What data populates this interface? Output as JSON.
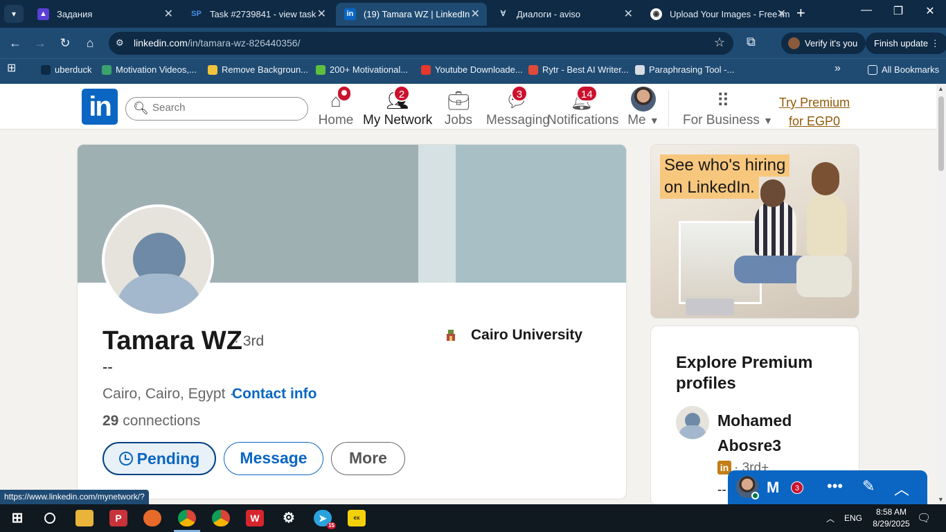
{
  "browser": {
    "tabs": [
      {
        "title": "Задания",
        "active": false
      },
      {
        "title": "Task #2739841 - view task",
        "active": false
      },
      {
        "title": "(19) Tamara WZ | LinkedIn",
        "active": true
      },
      {
        "title": "Диалоги - aviso",
        "active": false
      },
      {
        "title": "Upload Your Images - Free Im",
        "active": false
      }
    ],
    "url_host": "linkedin.com",
    "url_path": "/in/tamara-wz-826440356/",
    "verify_label": "Verify it's you",
    "update_label": "Finish update",
    "bookmarks": [
      "uberduck",
      "Motivation Videos,...",
      "Remove Backgroun...",
      "200+ Motivational...",
      "Youtube Downloade...",
      "Rytr - Best AI Writer...",
      "Paraphrasing Tool -..."
    ],
    "all_bookmarks": "All Bookmarks",
    "status_url": "https://www.linkedin.com/mynetwork/?"
  },
  "linkedin": {
    "logo": "in",
    "search_placeholder": "Search",
    "nav": {
      "home": "Home",
      "network": "My Network",
      "network_badge": "2",
      "jobs": "Jobs",
      "messaging": "Messaging",
      "messaging_badge": "3",
      "notifications": "Notifications",
      "notifications_badge": "14",
      "me": "Me",
      "business": "For Business",
      "premium_line1": "Try Premium",
      "premium_line2": "for EGP0"
    }
  },
  "profile": {
    "name": "Tamara WZ",
    "degree": "· 3rd",
    "headline": "--",
    "location": "Cairo, Cairo, Egypt ·",
    "contact_info": "Contact info",
    "connections_count": "29",
    "connections_label": "connections",
    "school": "Cairo University",
    "buttons": {
      "pending": "Pending",
      "message": "Message",
      "more": "More"
    }
  },
  "sidebar": {
    "ad_line1": "See who's hiring",
    "ad_line2": "on LinkedIn.",
    "premium_title": "Explore Premium profiles",
    "person_name": "Mohamed Abosre3",
    "person_degree": "· 3rd+",
    "person_headline": "--"
  },
  "messaging": {
    "initial": "M",
    "badge": "3"
  },
  "taskbar": {
    "telegram_badge": "15",
    "lang": "ENG",
    "time": "8:58 AM",
    "date": "8/29/2025"
  },
  "colors": {
    "linkedin_blue": "#0a66c2",
    "badge_red": "#cb112d",
    "premium_gold": "#915907",
    "browser_dark": "#0e2a45",
    "browser_mid": "#1f4b73"
  }
}
